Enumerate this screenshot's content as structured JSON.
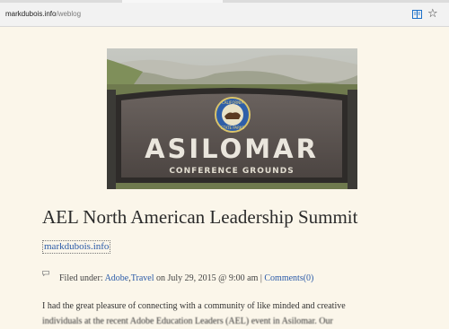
{
  "browser": {
    "url_host": "markdubois.info",
    "url_path": "/weblog",
    "reading_view_icon": "reading-view-icon",
    "favorite_icon": "favorite-star-icon"
  },
  "hero": {
    "sign_title": "ASILOMAR",
    "sign_subtitle": "CONFERENCE GROUNDS",
    "badge_top": "CALIFORNIA",
    "badge_bottom": "STATE PARKS"
  },
  "post": {
    "title": "AEL North American Leadership Summit",
    "site_link": "markdubois.info",
    "meta": {
      "filed_under_label": "Filed under:",
      "category_1": "Adobe",
      "separator": ",",
      "category_2": "Travel",
      "date_text": "on July 29, 2015 @ 9:00 am |",
      "comments": "Comments(0)"
    },
    "body_line_1": "I had the great pleasure of connecting with a community of like minded and creative",
    "body_line_2": "individuals at the recent Adobe Education Leaders (AEL) event in Asilomar. Our"
  },
  "colors": {
    "page_background": "#fbf6ea",
    "link": "#2a5aa8",
    "sign": "#5b5350"
  }
}
